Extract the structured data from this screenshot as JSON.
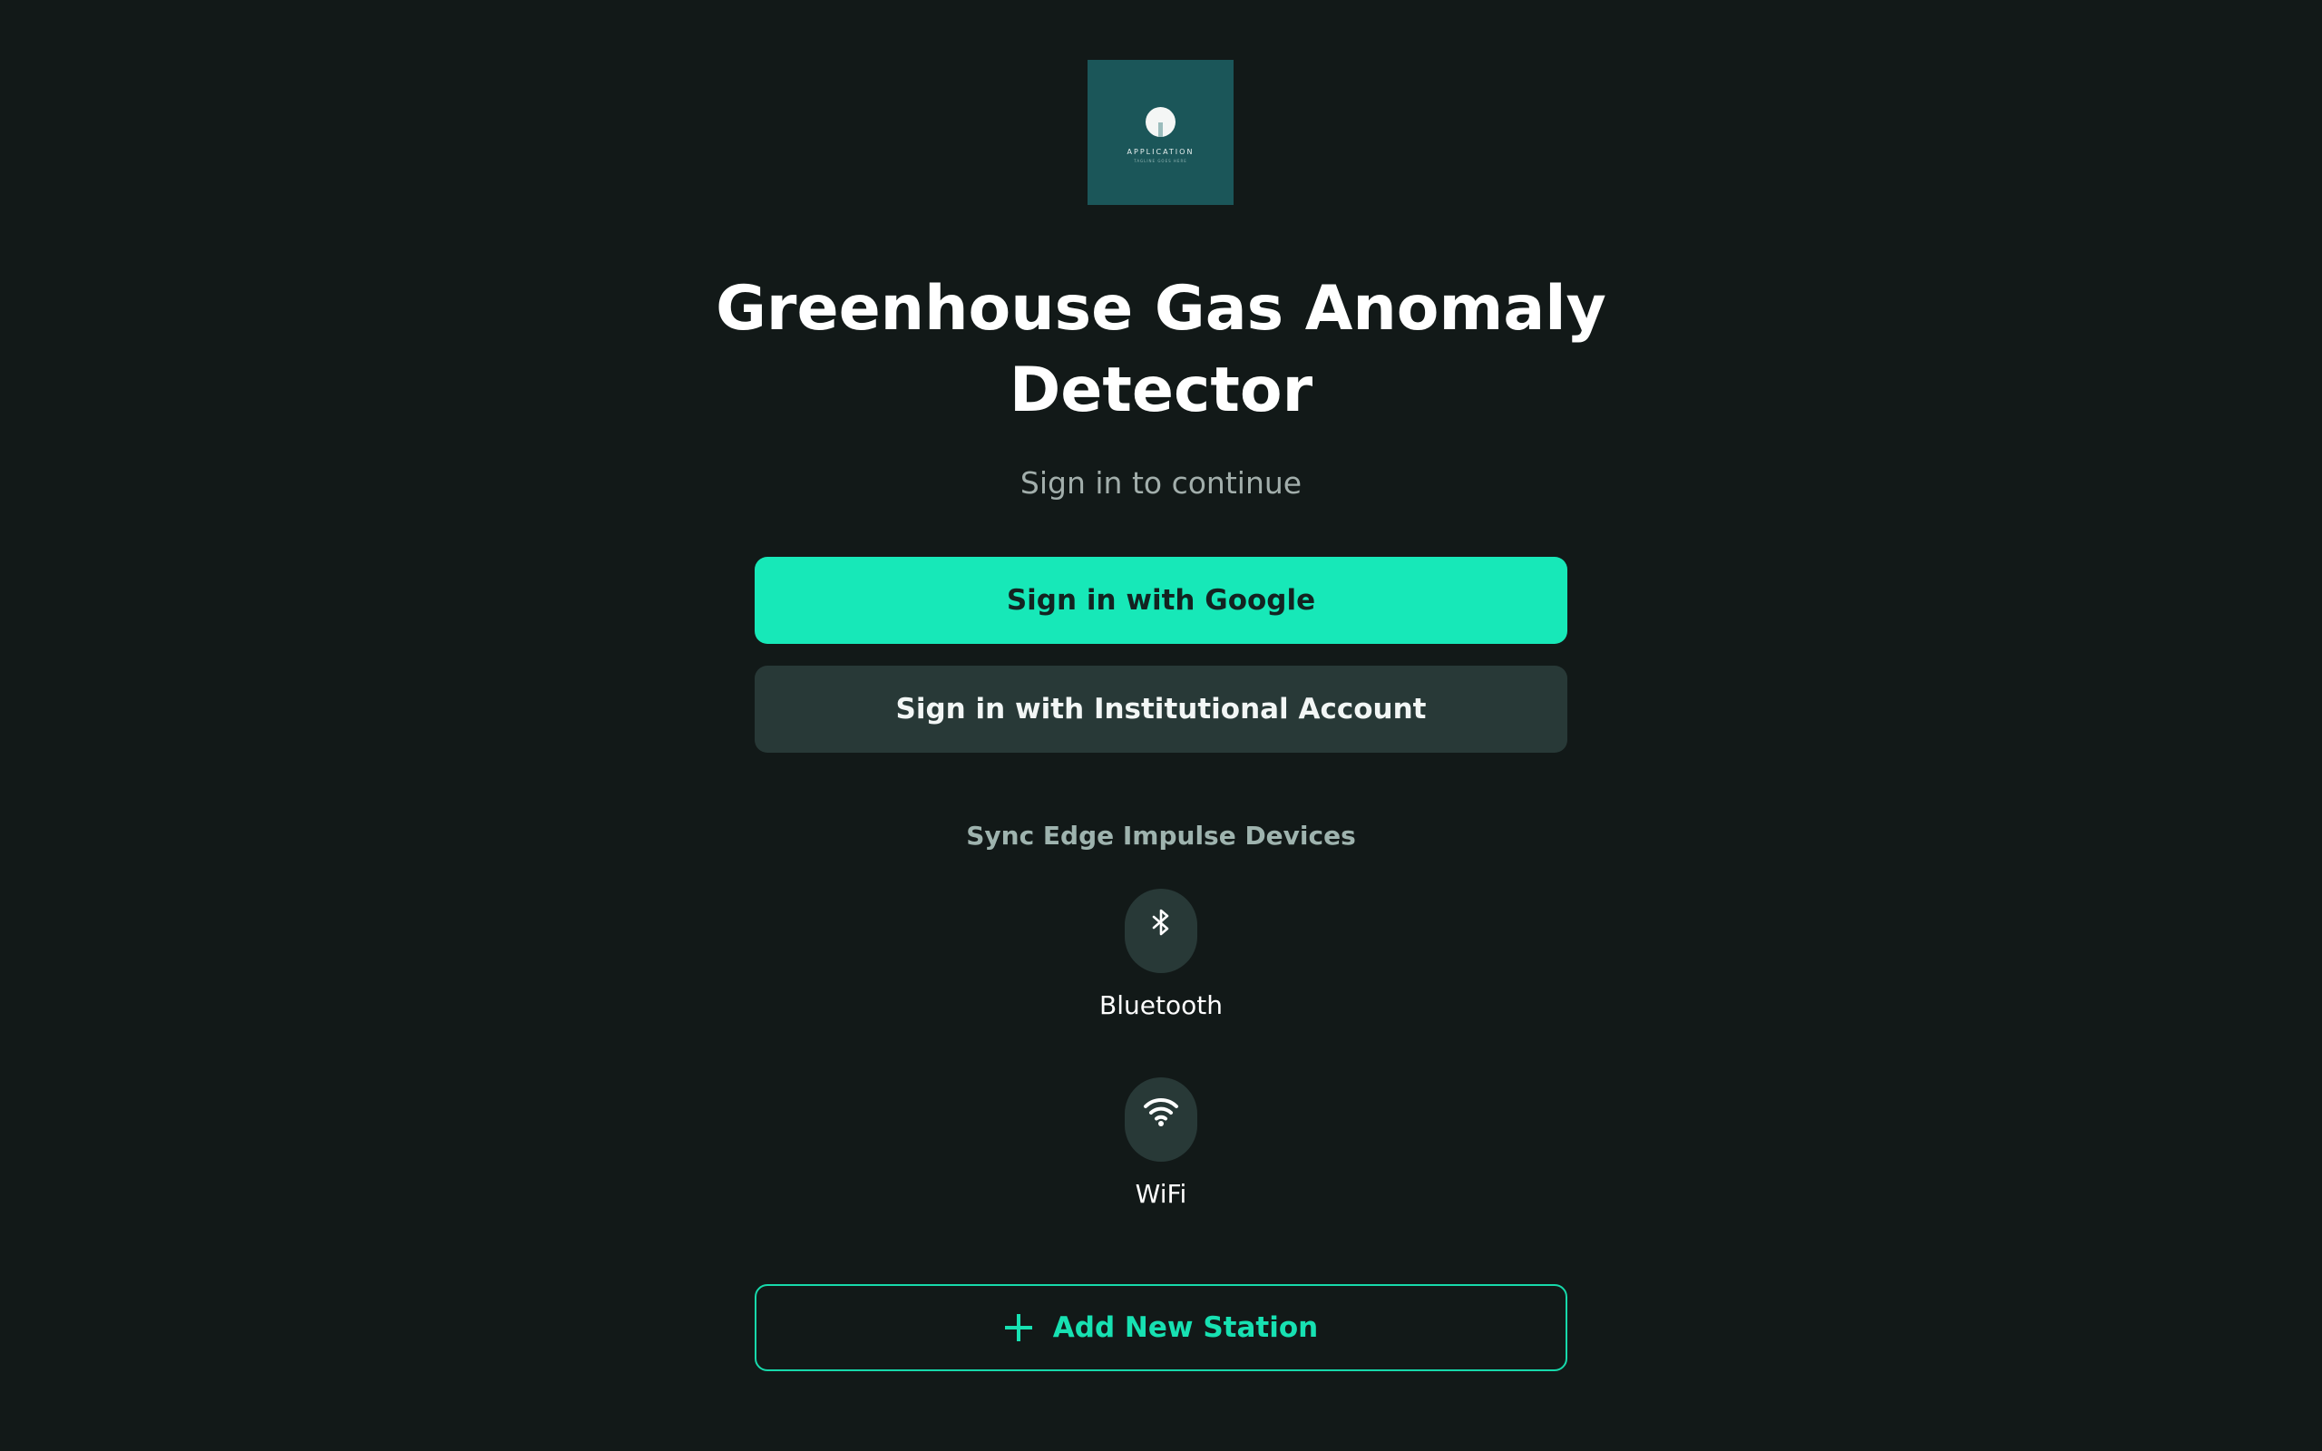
{
  "logo": {
    "text": "APPLICATION",
    "subtext": "TAGLINE GOES HERE"
  },
  "header": {
    "title": "Greenhouse Gas Anomaly Detector",
    "subtitle": "Sign in to continue"
  },
  "auth": {
    "google_label": "Sign in with Google",
    "institutional_label": "Sign in with Institutional Account"
  },
  "sync": {
    "heading": "Sync Edge Impulse Devices",
    "devices": [
      {
        "label": "Bluetooth",
        "icon": "bluetooth-icon"
      },
      {
        "label": "WiFi",
        "icon": "wifi-icon"
      }
    ]
  },
  "actions": {
    "add_station_label": "Add New Station",
    "add_icon": "plus-icon"
  },
  "colors": {
    "background": "#121918",
    "accent": "#17e8b8",
    "secondary_button": "#283937",
    "logo_background": "#1b5659"
  }
}
